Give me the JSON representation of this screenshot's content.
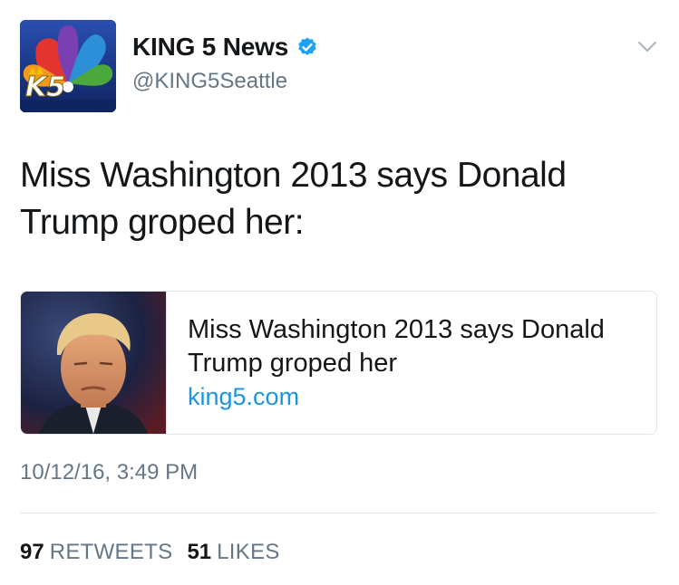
{
  "author": {
    "display_name": "KING 5 News",
    "handle": "@KING5Seattle",
    "verified": true,
    "avatar_icon": "king5-nbc-peacock-logo"
  },
  "tweet": {
    "text": "Miss Washington 2013 says Donald Trump groped her:",
    "timestamp": "10/12/16, 3:49 PM"
  },
  "card": {
    "title": "Miss Washington 2013 says Donald Trump groped her",
    "domain": "king5.com",
    "thumbnail": "news-photo-portrait"
  },
  "stats": {
    "retweets_count": "97",
    "retweets_label": "RETWEETS",
    "likes_count": "51",
    "likes_label": "LIKES"
  },
  "colors": {
    "link": "#1b95e0",
    "secondary_text": "#657786",
    "verified_badge": "#1da1f2",
    "border": "#e1e8ed"
  }
}
